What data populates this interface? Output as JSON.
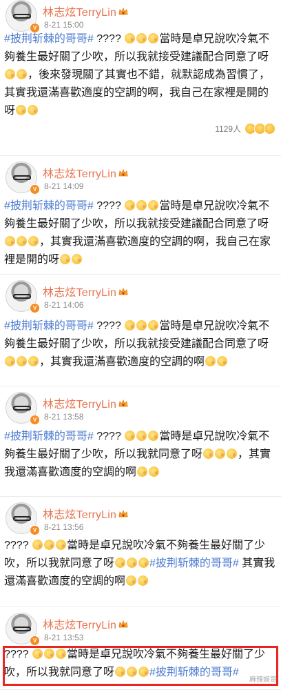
{
  "posts": [
    {
      "username": "林志炫TerryLin",
      "time": "8-21 15:00",
      "segments": [
        {
          "t": "#披荆斩棘的哥哥#",
          "tag": true
        },
        {
          "t": " ???? ",
          "tag": false
        },
        {
          "emoji": 3
        },
        {
          "t": "當時是卓兄說吹冷氣不夠養生最好關了少吹，所以我就接受建議配合同意了呀",
          "tag": false
        },
        {
          "emoji": 2
        },
        {
          "t": "，後來發現關了其實也不錯，就默認成為習慣了，其實我還滿喜歡適度的空調的啊，我自己在家裡是開的呀",
          "tag": false
        },
        {
          "emoji": 2
        }
      ],
      "likes": "1129人"
    },
    {
      "username": "林志炫TerryLin",
      "time": "8-21 14:09",
      "segments": [
        {
          "t": "#披荆斩棘的哥哥#",
          "tag": true
        },
        {
          "t": " ???? ",
          "tag": false
        },
        {
          "emoji": 3
        },
        {
          "t": "當時是卓兄說吹冷氣不夠養生最好關了少吹，所以我就接受建議配合同意了呀",
          "tag": false
        },
        {
          "emoji": 3
        },
        {
          "t": "，其實我還滿喜歡適度的空調的啊，我自己在家裡是開的呀",
          "tag": false
        },
        {
          "emoji": 2
        }
      ]
    },
    {
      "username": "林志炫TerryLin",
      "time": "8-21 14:06",
      "segments": [
        {
          "t": "#披荆斩棘的哥哥#",
          "tag": true
        },
        {
          "t": " ???? ",
          "tag": false
        },
        {
          "emoji": 3
        },
        {
          "t": "當時是卓兄說吹冷氣不夠養生最好關了少吹，所以我就接受建議配合同意了呀",
          "tag": false
        },
        {
          "emoji": 3
        },
        {
          "t": "，其實我還滿喜歡適度的空調的啊",
          "tag": false
        },
        {
          "emoji": 2
        }
      ]
    },
    {
      "username": "林志炫TerryLin",
      "time": "8-21 13:58",
      "segments": [
        {
          "t": "#披荆斩棘的哥哥#",
          "tag": true
        },
        {
          "t": " ???? ",
          "tag": false
        },
        {
          "emoji": 3
        },
        {
          "t": "當時是卓兄說吹冷氣不夠養生最好關了少吹，所以我就同意了呀",
          "tag": false
        },
        {
          "emoji": 3
        },
        {
          "t": "，其實我還滿喜歡適度的空調的啊",
          "tag": false
        },
        {
          "emoji": 2
        }
      ]
    },
    {
      "username": "林志炫TerryLin",
      "time": "8-21 13:56",
      "segments": [
        {
          "t": "???? ",
          "tag": false
        },
        {
          "emoji": 3
        },
        {
          "t": "當時是卓兄說吹冷氣不夠養生最好關了少吹，所以我就同意了呀",
          "tag": false
        },
        {
          "emoji": 3
        },
        {
          "t": "#披荆斩棘的哥哥#",
          "tag": true
        },
        {
          "t": " 其實我還滿喜歡適度的空調的啊",
          "tag": false
        },
        {
          "emoji": 2
        }
      ]
    },
    {
      "username": "林志炫TerryLin",
      "time": "8-21 13:53",
      "segments": [
        {
          "t": "???? ",
          "tag": false
        },
        {
          "emoji": 3
        },
        {
          "t": "當時是卓兄說吹冷氣不夠養生最好關了少吹，所以我就同意了呀",
          "tag": false
        },
        {
          "emoji": 3
        },
        {
          "t": "#披荆斩棘的哥哥#",
          "tag": true
        }
      ]
    }
  ],
  "watermark": "麻辣娱哥",
  "colors": {
    "username": "#eb7350",
    "hashtag": "#4d7bd1",
    "highlight": "#e8261f"
  }
}
